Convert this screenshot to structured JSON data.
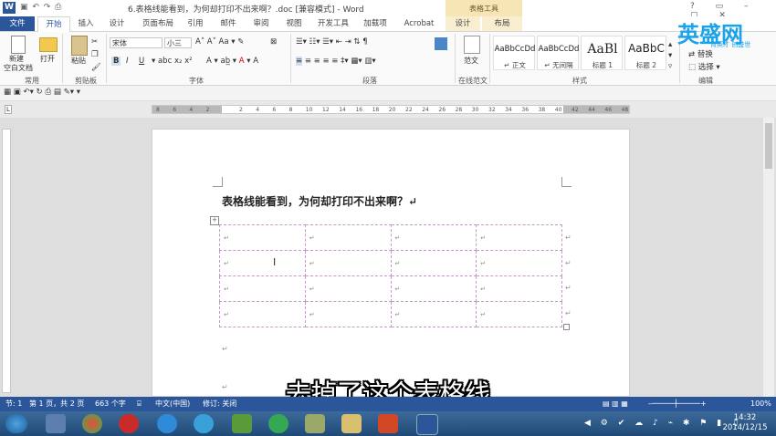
{
  "window": {
    "title": "6.表格线能看到，为何却打印不出来啊？.doc [兼容模式] - Word",
    "context_group": "表格工具",
    "controls": [
      "?",
      "▭",
      "–",
      "▢",
      "✕"
    ]
  },
  "tabs": [
    "文件",
    "开始",
    "插入",
    "设计",
    "页面布局",
    "引用",
    "邮件",
    "审阅",
    "视图",
    "开发工具",
    "加载项",
    "Acrobat",
    "设计",
    "布局"
  ],
  "ribbon": {
    "new_blank": "新建\n空白文档",
    "new_line1": "新建",
    "new_line2": "空白文档",
    "open": "打开",
    "paste": "粘贴",
    "group_common": "常用",
    "group_clipboard": "剪贴板",
    "font_name": "宋体",
    "font_size": "小三",
    "group_font": "字体",
    "group_paragraph": "段落",
    "template": "范文",
    "group_template": "在线范文",
    "styles": [
      {
        "sample": "AaBbCcDd",
        "name": "↵ 正文"
      },
      {
        "sample": "AaBbCcDd",
        "name": "↵ 无间隔"
      },
      {
        "sample": "AaBl",
        "name": "标题 1"
      },
      {
        "sample": "AaBbC",
        "name": "标题 2"
      }
    ],
    "group_styles": "样式",
    "replace": "替换",
    "select": "选择 ▾",
    "group_edit": "编辑"
  },
  "ruler": [
    "8",
    "6",
    "4",
    "2",
    "",
    "2",
    "4",
    "6",
    "8",
    "10",
    "12",
    "14",
    "16",
    "18",
    "20",
    "22",
    "24",
    "26",
    "28",
    "30",
    "32",
    "34",
    "36",
    "38",
    "40",
    "42",
    "44",
    "46",
    "48"
  ],
  "document": {
    "heading": "表格线能看到，为何却打印不出来啊？↵",
    "table": [
      [
        "↵",
        "↵",
        "↵",
        "↵"
      ],
      [
        "↵",
        "↵",
        "↵",
        "↵"
      ],
      [
        "↵",
        "↵",
        "↵",
        "↵"
      ],
      [
        "↵",
        "↵",
        "↵",
        "↵"
      ]
    ],
    "row_end_mark": "↵",
    "para_mark": "↵"
  },
  "subtitle": "去掉了这个表格线",
  "status": {
    "section": "节: 1",
    "page": "第 1 页，共 2 页",
    "words": "663 个字",
    "lang": "中文(中国)",
    "revision": "修订: 关闭",
    "zoom": "100%"
  },
  "taskbar": {
    "time": "14:32",
    "date": "2014/12/15"
  },
  "watermark": {
    "brand": "英盛网",
    "slogan": "育英才 创盛世"
  },
  "colors": {
    "word_blue": "#2b579a",
    "table_line": "#c39ac7",
    "context_tab": "#f6e6b6"
  }
}
